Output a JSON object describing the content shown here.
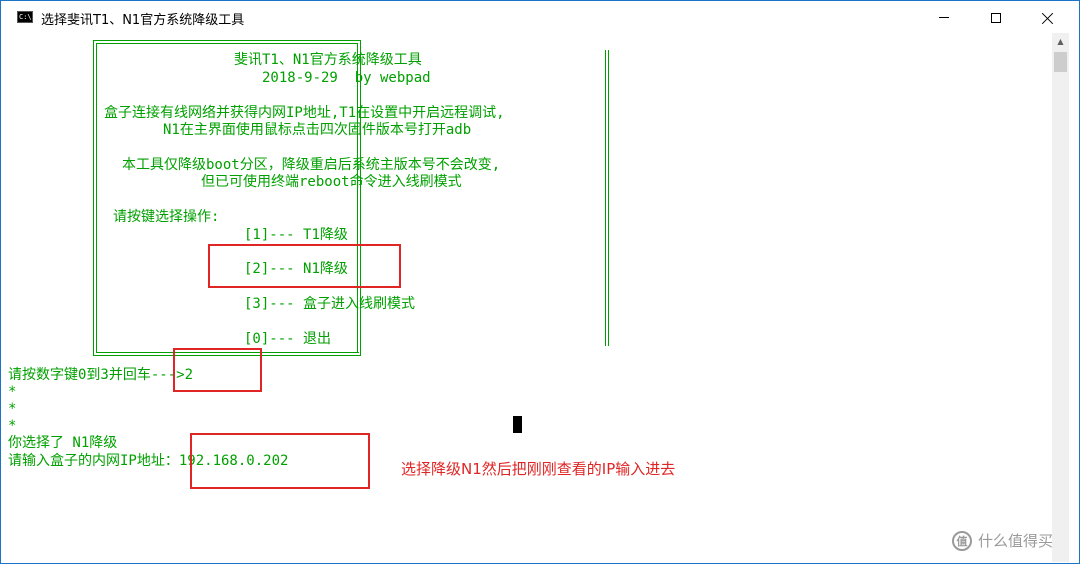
{
  "window": {
    "title": "选择斐讯T1、N1官方系统降级工具",
    "icon_label": "C:\\",
    "controls": [
      "minimize",
      "maximize",
      "close"
    ]
  },
  "console": {
    "header_title": "斐讯T1、N1官方系统降级工具",
    "header_date": "2018-9-29  by webpad",
    "info_line1": "盒子连接有线网络并获得内网IP地址,T1在设置中开启远程调试,",
    "info_line2": "N1在主界面使用鼠标点击四次固件版本号打开adb",
    "note_line1": "本工具仅降级boot分区，降级重启后系统主版本号不会改变,",
    "note_line2": "但已可使用终端reboot命令进入线刷模式",
    "prompt_select": "请按键选择操作:",
    "menu": [
      {
        "key": "[1]",
        "label": "T1降级"
      },
      {
        "key": "[2]",
        "label": "N1降级"
      },
      {
        "key": "[3]",
        "label": "盒子进入线刷模式"
      },
      {
        "key": "[0]",
        "label": "退出"
      }
    ],
    "menu_sep": "---",
    "input_prompt": "请按数字键0到3并回车--->",
    "input_value": "2",
    "stars": [
      "*",
      "*",
      "*"
    ],
    "chosen_text": "你选择了 N1降级",
    "ip_prompt": "请输入盒子的内网IP地址：",
    "ip_value": "192.168.0.202"
  },
  "annotation": {
    "text": "选择降级N1然后把刚刚查看的IP输入进去",
    "color": "#e02525"
  },
  "watermark": {
    "logo": "值",
    "text": "什么值得买"
  },
  "colors": {
    "console_text": "#00a000",
    "window_border": "#1c74c9",
    "highlight": "#e02525"
  }
}
